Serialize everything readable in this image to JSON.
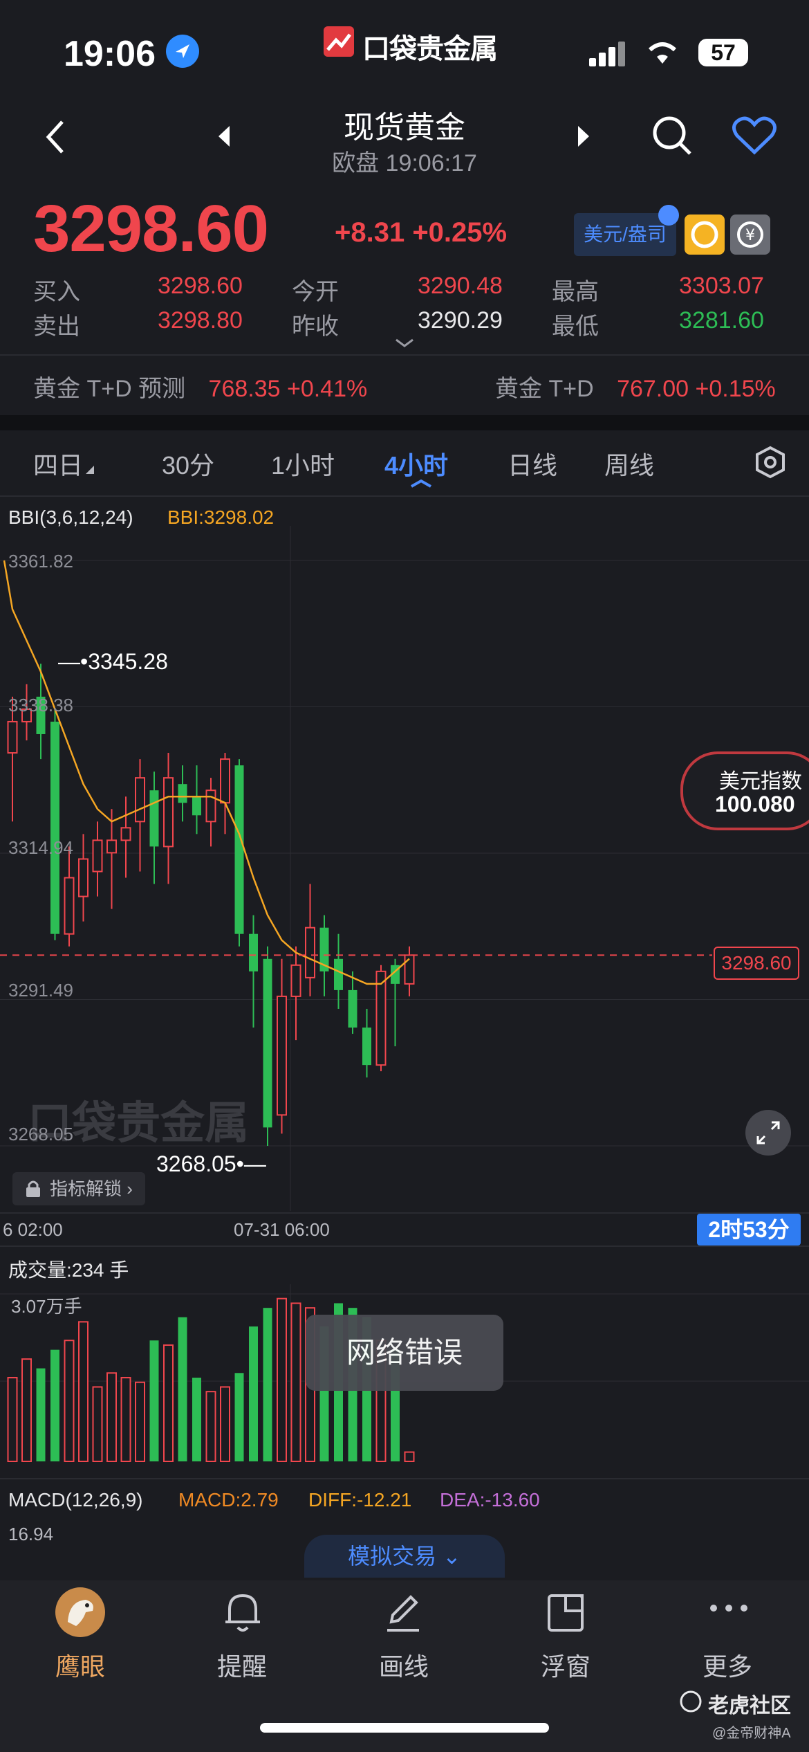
{
  "status_bar": {
    "time": "19:06",
    "battery": "57"
  },
  "app_logo": {
    "text": "口袋贵金属"
  },
  "nav": {
    "title": "现货黄金",
    "subtitle": "欧盘 19:06:17"
  },
  "quote": {
    "price": "3298.60",
    "change": "+8.31 +0.25%",
    "currency_toggle": "美元/盎司",
    "rows": [
      {
        "l1": "买入",
        "v1": "3298.60",
        "l2": "今开",
        "v2": "3290.48",
        "l3": "最高",
        "v3": "3303.07"
      },
      {
        "l1": "卖出",
        "v1": "3298.80",
        "l2": "昨收",
        "v2": "3290.29",
        "l3": "最低",
        "v3": "3281.60"
      }
    ]
  },
  "related": {
    "a_label": "黄金 T+D 预测",
    "a_value": "768.35 +0.41%",
    "b_label": "黄金 T+D",
    "b_value": "767.00 +0.15%"
  },
  "periods": [
    "四日",
    "30分",
    "1小时",
    "4小时",
    "日线",
    "周线"
  ],
  "active_period": "4小时",
  "indicator": {
    "name": "BBI(3,6,12,24)",
    "value": "BBI:3298.02"
  },
  "y_ticks": [
    "3361.82",
    "3338.38",
    "3314.94",
    "3291.49",
    "3268.05"
  ],
  "markers": {
    "high": "3345.28",
    "low": "3268.05",
    "last": "3298.60"
  },
  "x_ticks": [
    "6 02:00",
    "07-31 06:00"
  ],
  "countdown": "2时53分",
  "dxy": {
    "label": "美元指数",
    "value": "100.080"
  },
  "unlock": "指标解锁",
  "volume": {
    "label": "成交量:234 手",
    "max": "3.07万手"
  },
  "macd": {
    "name": "MACD(12,26,9)",
    "macd": "MACD:2.79",
    "diff": "DIFF:-12.21",
    "dea": "DEA:-13.60",
    "max": "16.94"
  },
  "sim_trade": "模拟交易",
  "toast": "网络错误",
  "bottom_nav": [
    "鹰眼",
    "提醒",
    "画线",
    "浮窗",
    "更多"
  ],
  "watermark": {
    "brand": "老虎社区",
    "author": "@金帝财神A"
  },
  "colors": {
    "up": "#f0464d",
    "down": "#2dbd55",
    "bbi": "#f5a623",
    "accent": "#4d8cff"
  },
  "chart_data": {
    "type": "candlestick",
    "ylim": [
      3268.05,
      3361.82
    ],
    "candles": [
      {
        "o": 3331,
        "h": 3340,
        "l": 3320,
        "c": 3336
      },
      {
        "o": 3336,
        "h": 3342,
        "l": 3333,
        "c": 3338
      },
      {
        "o": 3340,
        "h": 3345.28,
        "l": 3330,
        "c": 3334
      },
      {
        "o": 3336,
        "h": 3338,
        "l": 3301,
        "c": 3302
      },
      {
        "o": 3302,
        "h": 3316,
        "l": 3300,
        "c": 3311
      },
      {
        "o": 3308,
        "h": 3318,
        "l": 3304,
        "c": 3314
      },
      {
        "o": 3312,
        "h": 3320,
        "l": 3308,
        "c": 3317
      },
      {
        "o": 3315,
        "h": 3322,
        "l": 3306,
        "c": 3317
      },
      {
        "o": 3317,
        "h": 3324,
        "l": 3311,
        "c": 3319
      },
      {
        "o": 3320,
        "h": 3330,
        "l": 3312,
        "c": 3327
      },
      {
        "o": 3325,
        "h": 3328,
        "l": 3310,
        "c": 3316
      },
      {
        "o": 3316,
        "h": 3331,
        "l": 3310,
        "c": 3327
      },
      {
        "o": 3326,
        "h": 3329,
        "l": 3320,
        "c": 3323
      },
      {
        "o": 3324,
        "h": 3329,
        "l": 3318,
        "c": 3321
      },
      {
        "o": 3320,
        "h": 3327,
        "l": 3316,
        "c": 3325
      },
      {
        "o": 3323,
        "h": 3331,
        "l": 3318,
        "c": 3330
      },
      {
        "o": 3329,
        "h": 3330,
        "l": 3300,
        "c": 3302
      },
      {
        "o": 3302,
        "h": 3305,
        "l": 3287,
        "c": 3296
      },
      {
        "o": 3298,
        "h": 3300,
        "l": 3268.05,
        "c": 3271
      },
      {
        "o": 3273,
        "h": 3298,
        "l": 3270,
        "c": 3292
      },
      {
        "o": 3292,
        "h": 3300,
        "l": 3285,
        "c": 3297
      },
      {
        "o": 3295,
        "h": 3310,
        "l": 3292,
        "c": 3303
      },
      {
        "o": 3303,
        "h": 3305,
        "l": 3292,
        "c": 3296
      },
      {
        "o": 3298,
        "h": 3302,
        "l": 3290,
        "c": 3293
      },
      {
        "o": 3293,
        "h": 3296,
        "l": 3286,
        "c": 3287
      },
      {
        "o": 3287,
        "h": 3290,
        "l": 3279,
        "c": 3281
      },
      {
        "o": 3281,
        "h": 3297,
        "l": 3280,
        "c": 3296
      },
      {
        "o": 3297,
        "h": 3298,
        "l": 3284,
        "c": 3294
      },
      {
        "o": 3294,
        "h": 3300,
        "l": 3292,
        "c": 3298.6
      }
    ],
    "bbi": [
      3354,
      3349,
      3344,
      3338,
      3332,
      3326,
      3322,
      3320,
      3321,
      3322,
      3323,
      3324,
      3324,
      3324,
      3324,
      3323,
      3318,
      3311,
      3305,
      3301,
      3299,
      3298,
      3297,
      3296,
      3295,
      3294,
      3294,
      3296,
      3298.02
    ],
    "volume": [
      18,
      22,
      20,
      24,
      26,
      30,
      16,
      19,
      18,
      17,
      26,
      25,
      31,
      18,
      15,
      16,
      19,
      29,
      33,
      35,
      34,
      33,
      29,
      34,
      33,
      31,
      26,
      24,
      2
    ]
  }
}
